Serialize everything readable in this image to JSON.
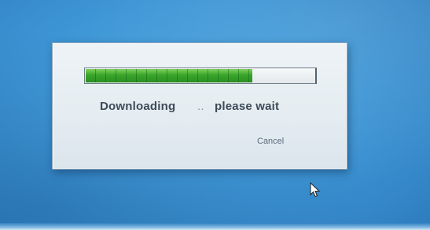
{
  "dialog": {
    "progress": {
      "percent": 73,
      "fill_color": "#39a52a"
    },
    "status": {
      "word": "Downloading",
      "separator": "..",
      "wait": "please wait"
    },
    "cancel_label": "Cancel"
  },
  "desktop": {
    "background_color": "#3f97d6"
  },
  "icons": {
    "cursor": "mouse-pointer-icon"
  }
}
